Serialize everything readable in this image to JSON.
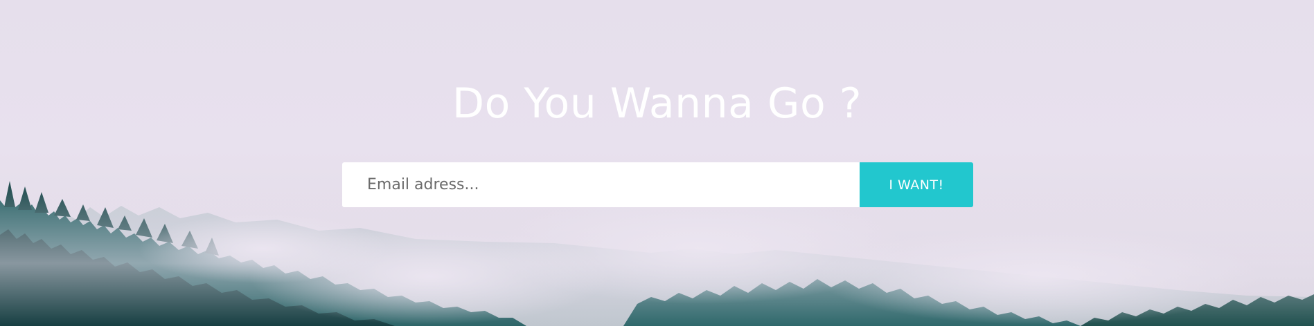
{
  "hero": {
    "headline": "Do You Wanna Go ?",
    "background_image": "misty-forest"
  },
  "subscribe": {
    "email_placeholder": "Email adress...",
    "email_value": "",
    "button_label": "I WANT!"
  },
  "colors": {
    "sky": "#e6dfec",
    "forest_dark": "#1f4a4c",
    "forest_teal": "#2f6f73",
    "accent_button": "#22c7ce",
    "text_light": "#ffffff"
  }
}
